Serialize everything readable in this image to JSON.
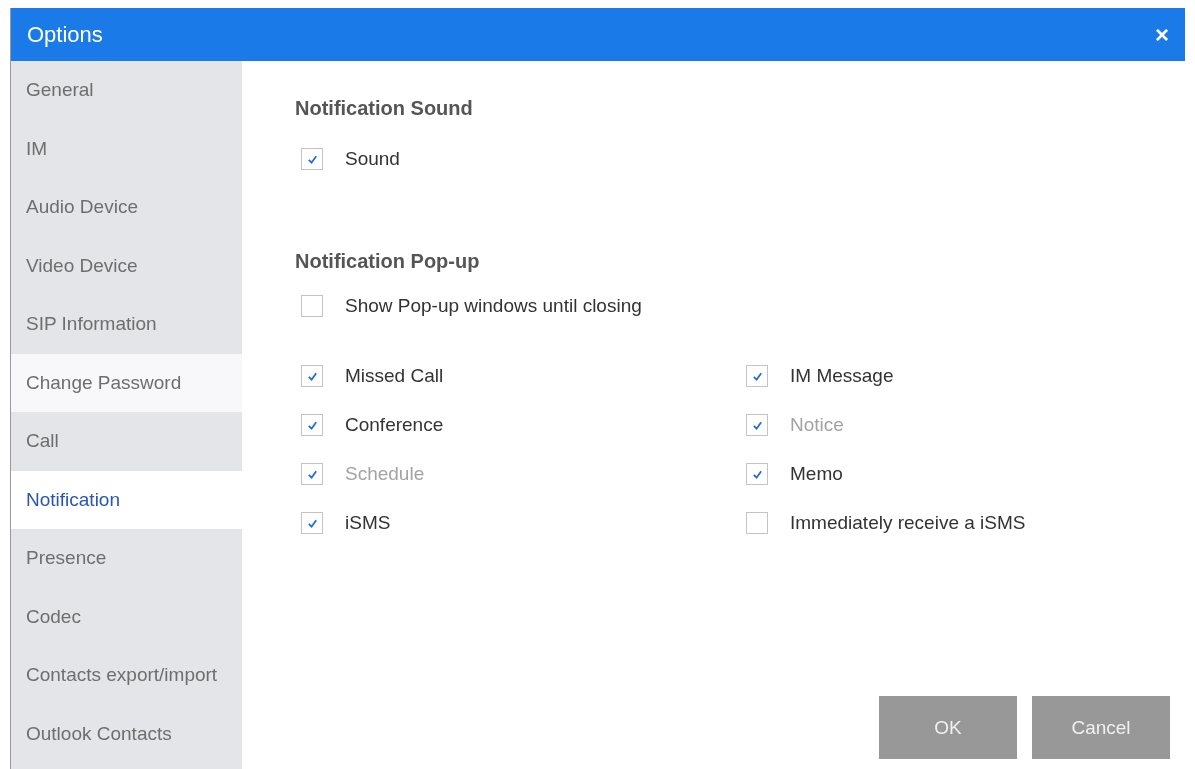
{
  "window": {
    "title": "Options",
    "close": "×"
  },
  "sidebar": {
    "items": [
      {
        "label": "General",
        "selected": false,
        "hovered": false
      },
      {
        "label": "IM",
        "selected": false,
        "hovered": false
      },
      {
        "label": "Audio Device",
        "selected": false,
        "hovered": false
      },
      {
        "label": "Video Device",
        "selected": false,
        "hovered": false
      },
      {
        "label": "SIP Information",
        "selected": false,
        "hovered": false
      },
      {
        "label": "Change Password",
        "selected": false,
        "hovered": true
      },
      {
        "label": "Call",
        "selected": false,
        "hovered": false
      },
      {
        "label": "Notification",
        "selected": true,
        "hovered": false
      },
      {
        "label": "Presence",
        "selected": false,
        "hovered": false
      },
      {
        "label": "Codec",
        "selected": false,
        "hovered": false
      },
      {
        "label": "Contacts export/import",
        "selected": false,
        "hovered": false
      },
      {
        "label": "Outlook Contacts",
        "selected": false,
        "hovered": false
      }
    ]
  },
  "sound_section": {
    "heading": "Notification Sound",
    "options": [
      {
        "label": "Sound",
        "checked": true,
        "disabled": false
      }
    ]
  },
  "popup_section": {
    "heading": "Notification Pop-up",
    "show_until_closing": {
      "label": "Show Pop-up windows until closing",
      "checked": false,
      "disabled": false
    },
    "left_options": [
      {
        "label": "Missed Call",
        "checked": true,
        "disabled": false
      },
      {
        "label": "Conference",
        "checked": true,
        "disabled": false
      },
      {
        "label": "Schedule",
        "checked": true,
        "disabled": true
      },
      {
        "label": "iSMS",
        "checked": true,
        "disabled": false
      }
    ],
    "right_options": [
      {
        "label": "IM Message",
        "checked": true,
        "disabled": false
      },
      {
        "label": "Notice",
        "checked": true,
        "disabled": true
      },
      {
        "label": "Memo",
        "checked": true,
        "disabled": false
      },
      {
        "label": "Immediately receive a iSMS",
        "checked": false,
        "disabled": false
      }
    ]
  },
  "buttons": [
    "OK",
    "Cancel"
  ]
}
